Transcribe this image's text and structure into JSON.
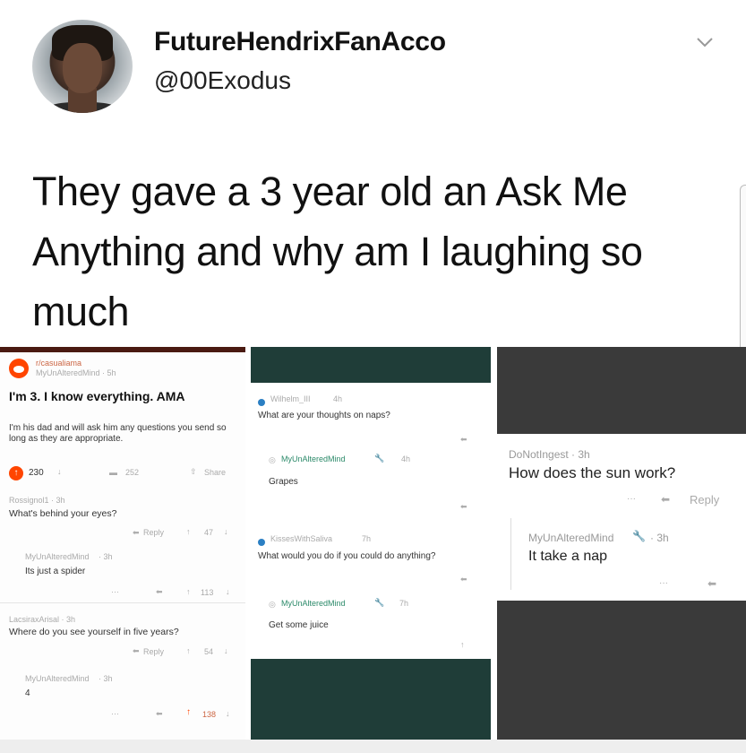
{
  "tweet": {
    "display_name": "FutureHendrixFanAcco",
    "handle": "@00Exodus",
    "text": "They gave a 3 year old an Ask Me Anything and why am I laughing so much"
  },
  "panel1": {
    "subreddit": "r/casualiama",
    "op_meta": "MyUnAlteredMind · 5h",
    "title": "I'm 3. I know everything. AMA",
    "body": "I'm his dad and will ask him any questions you send so long as they are appropriate.",
    "score": "230",
    "comments": "252",
    "share": "Share",
    "c1_user": "Rossignol1 · 3h",
    "c1_text": "What's behind your eyes?",
    "c1_reply": "Reply",
    "c1_votes": "47",
    "r1_user": "MyUnAlteredMind",
    "r1_time": "· 3h",
    "r1_text": "Its just a spider",
    "r1_votes": "113",
    "c2_user": "LacsiraxArisal · 3h",
    "c2_text": "Where do you see yourself in five years?",
    "c2_reply": "Reply",
    "c2_votes": "54",
    "r2_user": "MyUnAlteredMind",
    "r2_time": "· 3h",
    "r2_text": "4",
    "r2_votes": "138"
  },
  "panel2": {
    "c1_user": "Wilhelm_III",
    "c1_time": "4h",
    "c1_text": "What are your thoughts on naps?",
    "r1_user": "MyUnAlteredMind",
    "r1_time": "4h",
    "r1_text": "Grapes",
    "c2_user": "KissesWithSaliva",
    "c2_time": "7h",
    "c2_text": "What would you do if you could do anything?",
    "r2_user": "MyUnAlteredMind",
    "r2_time": "7h",
    "r2_text": "Get some juice"
  },
  "panel3": {
    "c1_user": "DoNotIngest · 3h",
    "c1_text": "How does the sun work?",
    "c1_reply": "Reply",
    "r1_user": "MyUnAlteredMind",
    "r1_time": "· 3h",
    "r1_text": "It take a nap"
  },
  "icons": {
    "more": "···",
    "upvote": "↑",
    "downvote": "↓",
    "reply_arrow": "⬅"
  },
  "colors": {
    "reddit_orange": "#ff4500",
    "dark_green": "#1f3d38",
    "dark_gray": "#3a3a3a",
    "accent_green": "#2c8a6a"
  }
}
